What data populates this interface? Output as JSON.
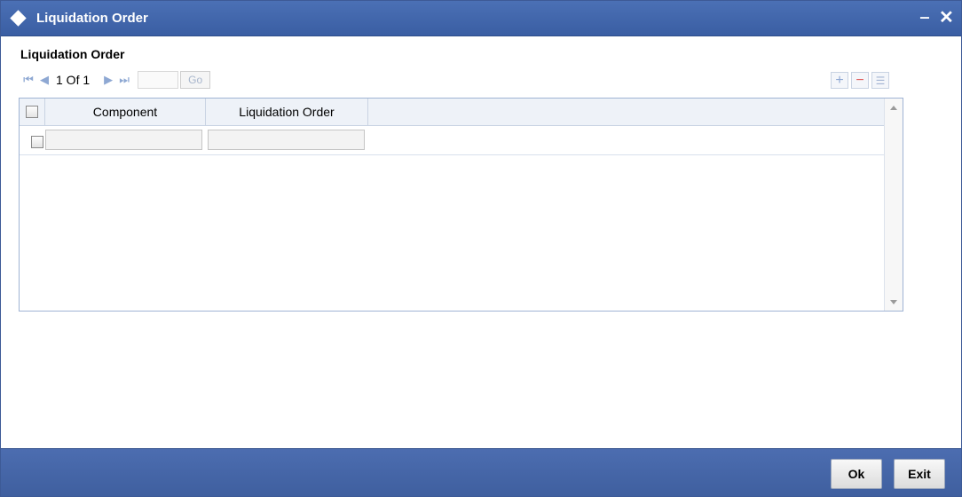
{
  "window": {
    "title": "Liquidation Order",
    "minimize_label": "‒",
    "close_label": "✕"
  },
  "section": {
    "title": "Liquidation Order"
  },
  "pager": {
    "first_icon": "first-page-icon",
    "prev_icon": "previous-page-icon",
    "next_icon": "next-page-icon",
    "last_icon": "last-page-icon",
    "first_glyph": "⏮",
    "prev_glyph": "◀",
    "next_glyph": "▶",
    "last_glyph": "⏭",
    "page_info": "1 Of 1",
    "goto_value": "",
    "go_label": "Go"
  },
  "grid_actions": {
    "add_glyph": "+",
    "delete_glyph": "−",
    "view_glyph": "☰"
  },
  "table": {
    "columns": [
      "Component",
      "Liquidation Order"
    ],
    "rows": [
      {
        "component": "",
        "liquidation_order": ""
      }
    ]
  },
  "footer": {
    "ok_label": "Ok",
    "exit_label": "Exit"
  },
  "colors": {
    "titlebar": "#3f63a8",
    "footer": "#4466aa",
    "grid_border": "#9fb3d4",
    "nav_icon": "#8ea8d3",
    "delete_icon": "#e05a5a"
  }
}
